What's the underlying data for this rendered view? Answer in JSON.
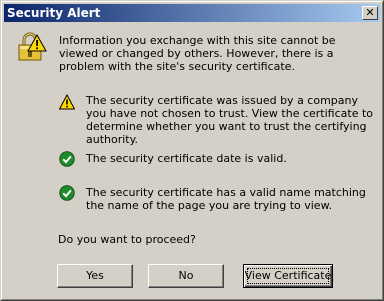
{
  "window": {
    "title": "Security Alert",
    "close_glyph": "✕"
  },
  "intro": {
    "icon": "lock-warning-icon",
    "text": "Information you exchange with this site cannot be viewed or changed by others. However, there is a problem with the site's security certificate."
  },
  "items": [
    {
      "icon": "warning-icon",
      "status": "warning",
      "text": "The security certificate was issued by a company you have not chosen to trust. View the certificate to determine whether you want to trust the certifying authority."
    },
    {
      "icon": "check-icon",
      "status": "ok",
      "text": "The security certificate date is valid."
    },
    {
      "icon": "check-icon",
      "status": "ok",
      "text": "The security certificate has a valid name matching the name of the page you are trying to view."
    }
  ],
  "question": "Do you want to proceed?",
  "buttons": {
    "yes": "Yes",
    "no": "No",
    "view_certificate": "View Certificate"
  },
  "colors": {
    "titlebar_start": "#0a246a",
    "titlebar_end": "#a6caf0",
    "face": "#d4d0c8",
    "ok_green": "#1f8a2b",
    "warning_yellow": "#ffd800"
  }
}
